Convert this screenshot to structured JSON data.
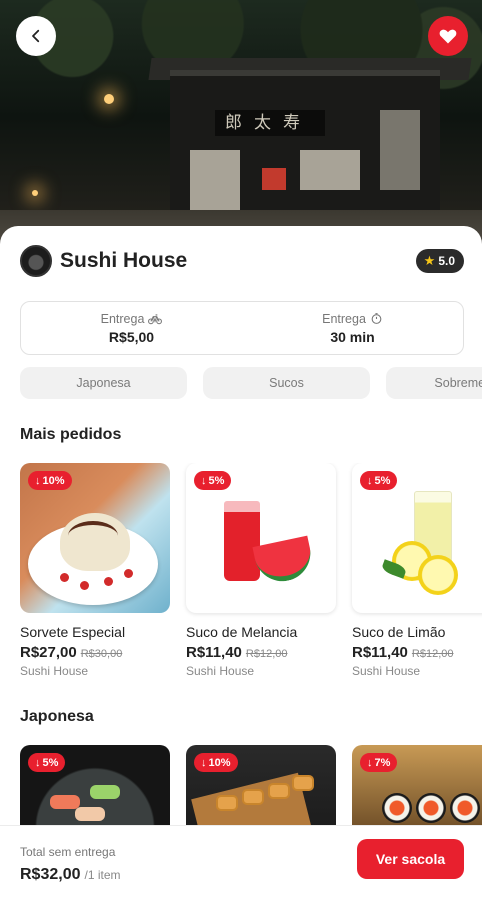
{
  "header": {
    "back_icon": "chevron-left-icon",
    "favorite_icon": "heart-icon",
    "sign_text": "郎太寿"
  },
  "store": {
    "name": "Sushi House",
    "rating": "5.0"
  },
  "delivery": {
    "fee_label": "Entrega",
    "fee_value": "R$5,00",
    "time_label": "Entrega",
    "time_value": "30 min"
  },
  "categories": [
    "Japonesa",
    "Sucos",
    "Sobremesas"
  ],
  "sections": {
    "popular_title": "Mais pedidos",
    "japanese_title": "Japonesa"
  },
  "popular": [
    {
      "discount": "10%",
      "name": "Sorvete Especial",
      "price": "R$27,00",
      "old_price": "R$30,00",
      "store": "Sushi House"
    },
    {
      "discount": "5%",
      "name": "Suco de Melancia",
      "price": "R$11,40",
      "old_price": "R$12,00",
      "store": "Sushi House"
    },
    {
      "discount": "5%",
      "name": "Suco de Limão",
      "price": "R$11,40",
      "old_price": "R$12,00",
      "store": "Sushi House"
    }
  ],
  "japanese": [
    {
      "discount": "5%"
    },
    {
      "discount": "10%"
    },
    {
      "discount": "7%"
    }
  ],
  "bottom": {
    "total_label": "Total sem entrega",
    "total_value": "R$32,00",
    "items": "/1 item",
    "cart_button": "Ver sacola"
  },
  "colors": {
    "accent": "#e8202e",
    "rating_bg": "#2b2b2b"
  }
}
